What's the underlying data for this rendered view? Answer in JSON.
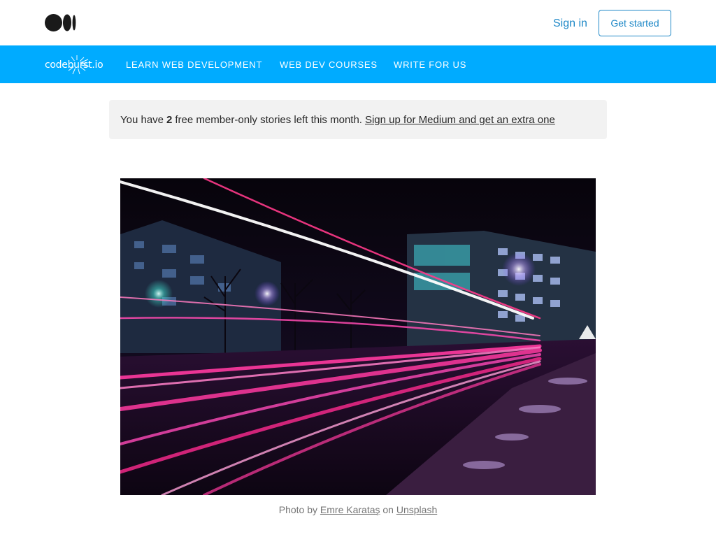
{
  "header": {
    "logo_icon": "medium-logo-icon",
    "signin_label": "Sign in",
    "getstarted_label": "Get started",
    "accent_color": "#1e88c7"
  },
  "publication": {
    "logo_text": "codeburst.io",
    "background_color": "#00abff",
    "nav": [
      {
        "label": "LEARN WEB DEVELOPMENT"
      },
      {
        "label": "WEB DEV COURSES"
      },
      {
        "label": "WRITE FOR US"
      }
    ]
  },
  "banner": {
    "prefix": "You have",
    "count": "2",
    "middle": "free member-only stories left this month.",
    "link": "Sign up for Medium and get an extra one"
  },
  "hero": {
    "image_icon": "light-trails-photo"
  },
  "caption": {
    "prefix": "Photo by",
    "author": "Emre Karataş",
    "middle": "on",
    "source": "Unsplash"
  }
}
